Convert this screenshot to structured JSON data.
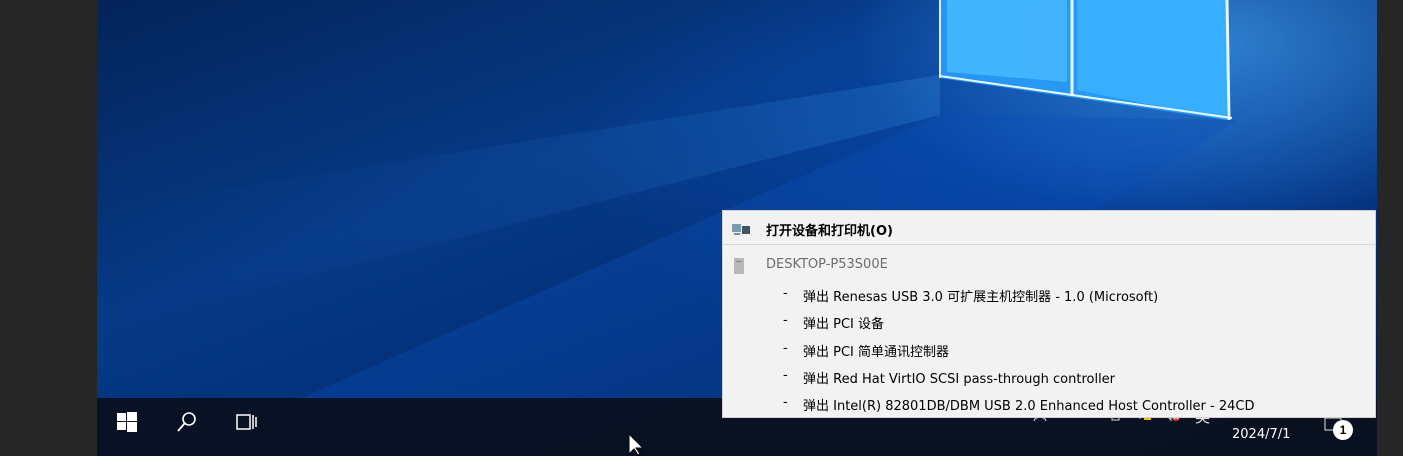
{
  "context_menu": {
    "open_devices_label": "打开设备和打印机(O)",
    "device_name": "DESKTOP-P53S00E",
    "items": [
      {
        "dash": "-",
        "label": "弹出 Renesas USB 3.0 可扩展主机控制器 - 1.0 (Microsoft)"
      },
      {
        "dash": "-",
        "label": "弹出 PCI 设备"
      },
      {
        "dash": "-",
        "label": "弹出 PCI 简单通讯控制器"
      },
      {
        "dash": "-",
        "label": "弹出 Red Hat VirtIO SCSI pass-through controller"
      },
      {
        "dash": "-",
        "label": "弹出 Intel(R) 82801DB/DBM USB 2.0 Enhanced Host Controller - 24CD"
      }
    ]
  },
  "taskbar": {
    "language_indicator": "英",
    "clock_date": "2024/7/1",
    "notification_count": "1",
    "icons": [
      "windows-start-icon",
      "search-icon",
      "task-view-icon",
      "people-icon",
      "chevron-up-icon",
      "usb-eject-icon",
      "network-icon",
      "speaker-muted-icon",
      "notification-icon"
    ]
  },
  "colors": {
    "wallpaper_blue": "#063a86",
    "menu_background": "#f2f2f2",
    "taskbar": "#0a101e"
  }
}
